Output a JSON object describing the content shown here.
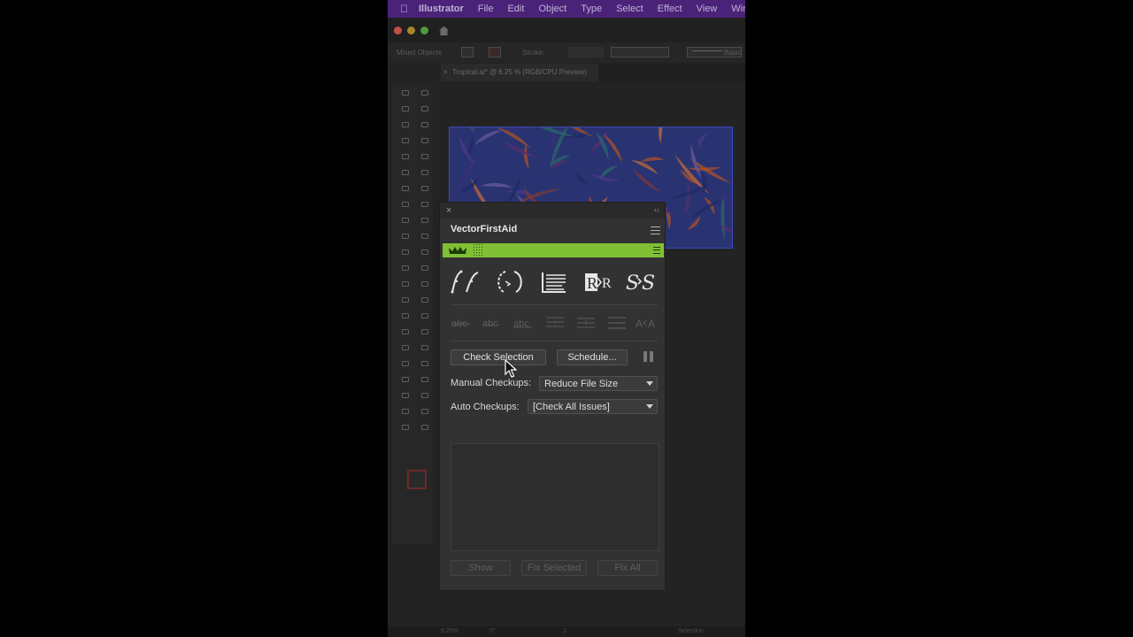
{
  "menubar": {
    "app_name": "Illustrator",
    "items": [
      "File",
      "Edit",
      "Object",
      "Type",
      "Select",
      "Effect",
      "View",
      "Windo"
    ]
  },
  "control_bar": {
    "selection_label": "Mixed Objects",
    "stroke_label": "Stroke:",
    "style_label": "Basic"
  },
  "document": {
    "tab_title": "Tropical.ai* @ 6.25 % (RGB/CPU Preview)",
    "close_glyph": "×"
  },
  "status_bar": {
    "zoom": "6.25%",
    "rotation": "0°",
    "artboard": "1",
    "tool": "Selection"
  },
  "panel": {
    "close_glyph": "×",
    "collapse_glyph": "‹‹",
    "title": "VectorFirstAid",
    "top_tools": [
      {
        "icon": "simplify-paths-icon"
      },
      {
        "icon": "join-paths-icon"
      },
      {
        "icon": "text-lines-icon"
      },
      {
        "icon": "replace-font-icon"
      },
      {
        "icon": "style-swap-icon"
      }
    ],
    "mini_tools": [
      {
        "icon": "text-strike-1-icon"
      },
      {
        "icon": "text-strike-2-icon"
      },
      {
        "icon": "text-strike-3-icon"
      },
      {
        "icon": "align-lines-1-icon"
      },
      {
        "icon": "align-lines-2-icon"
      },
      {
        "icon": "align-lines-3-icon"
      },
      {
        "icon": "text-to-outline-icon"
      }
    ],
    "check_selection_label": "Check Selection",
    "schedule_label": "Schedule...",
    "manual_label": "Manual Checkups:",
    "manual_value": "Reduce File Size",
    "auto_label": "Auto Checkups:",
    "auto_value": "[Check All Issues]",
    "show_label": "Show",
    "fix_selected_label": "Fix Selected",
    "fix_all_label": "Fix All"
  },
  "colors": {
    "menubar_bg": "#4a2378",
    "accent_green": "#7fc035",
    "panel_bg": "#323232"
  }
}
